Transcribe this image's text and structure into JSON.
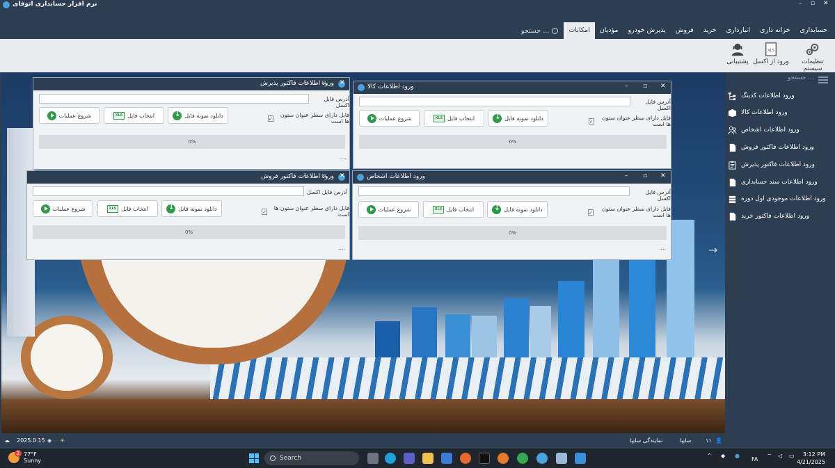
{
  "window": {
    "title": "نرم افزار حسابداری اتوفای",
    "controls": {
      "minimize": "–",
      "restore": "▫",
      "close": "✕"
    }
  },
  "menu": {
    "tabs": [
      "حسابداری",
      "خزانه داری",
      "انبارداری",
      "خرید",
      "فروش",
      "پذیرش خودرو",
      "مؤدیان",
      "امکانات"
    ],
    "active_tab": "امکانات",
    "search_label": "جستجو ..."
  },
  "ribbon": {
    "buttons": [
      {
        "label": "تنظیمات سیستم",
        "icon": "gears-icon"
      },
      {
        "label": "ورود از اکسل",
        "icon": "excel-file-icon"
      },
      {
        "label": "پشتیبانی",
        "icon": "support-agent-icon"
      }
    ]
  },
  "sidebar": {
    "search_placeholder": "... جستجو",
    "items": [
      {
        "label": "ورود اطلاعات کدینگ",
        "icon": "hierarchy-icon"
      },
      {
        "label": "ورود اطلاعات کالا",
        "icon": "box-icon"
      },
      {
        "label": "ورود اطلاعات اشخاص",
        "icon": "people-icon"
      },
      {
        "label": "ورود اطلاعات فاکتور فروش",
        "icon": "invoice-icon"
      },
      {
        "label": "ورود اطلاعات فاکتور پذیرش",
        "icon": "clipboard-icon"
      },
      {
        "label": "ورود اطلاعات سند حسابداری",
        "icon": "document-icon"
      },
      {
        "label": "ورود اطلاعات موجودی اول دوره",
        "icon": "stack-icon"
      },
      {
        "label": "ورود اطلاعات فاکتور خرید",
        "icon": "invoice-icon"
      }
    ]
  },
  "dialog_common": {
    "address_label": "آدرس فایل اکسل",
    "header_row_label": "فایل دارای سطر عنوان ستون ها است",
    "header_row_checked": "✓",
    "download_sample_label": "دانلود نمونه فایل",
    "select_file_label": "انتخاب فایل",
    "start_label": "شروع عملیات",
    "progress_label": "0%",
    "status_dots": "....",
    "xls_badge": "XLS"
  },
  "dialogs": [
    {
      "title": "ورود اطلاعات فاکتور پذیرش"
    },
    {
      "title": "ورود اطلاعات کالا"
    },
    {
      "title": "ورود اطلاعات فاکتور فروش"
    },
    {
      "title": "ورود اطلاعات اشخاص"
    }
  ],
  "statusbar": {
    "version": "2025.0.15",
    "user_count": "۱۱",
    "company": "سایپا",
    "agency": "نمایندگی سایپا"
  },
  "taskbar": {
    "weather_temp": "77°F",
    "weather_desc": "Sunny",
    "weather_badge": "2",
    "search_label": "Search",
    "lang": "FA",
    "time": "3:12 PM",
    "date": "4/21/2025"
  },
  "colors": {
    "chrome": "#2e3e52",
    "ribbon": "#e9ecef",
    "accent_green": "#2e9a4a",
    "logo_blue": "#4aa3df"
  }
}
